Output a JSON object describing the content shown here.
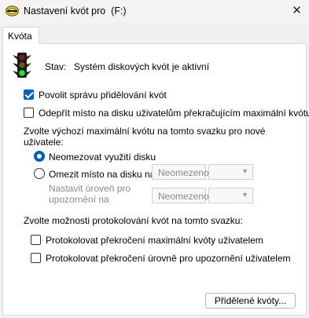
{
  "window": {
    "title": "Nastavení kvót pro  (F:)",
    "close_glyph": "✕"
  },
  "tabs": [
    {
      "label": "Kvóta"
    }
  ],
  "status": {
    "label": "Stav:",
    "value": "Systém diskových kvót je aktivní"
  },
  "options": {
    "enable_management": {
      "label": "Povolit správu přidělování kvót",
      "checked": true
    },
    "deny_space": {
      "label": "Odepřít místo na disku uživatelům překračujícím maximální kvótu",
      "checked": false
    }
  },
  "default_quota": {
    "heading_line1": "Zvolte výchozí maximální kvótu na tomto svazku pro nové",
    "heading_line2": "uživatele:",
    "no_limit": {
      "label": "Neomezovat využití disku",
      "selected": true
    },
    "limit": {
      "label": "Omezit místo na disku na",
      "selected": false,
      "value": "Neomezeno"
    },
    "warning": {
      "label_line1": "Nastavit úroveň pro",
      "label_line2": "upozornění na",
      "value": "Neomezeno"
    }
  },
  "logging": {
    "heading": "Zvolte možnosti protokolování kvót na tomto svazku:",
    "log_limit": {
      "label": "Protokolovat překročení maximální kvóty uživatelem",
      "checked": false
    },
    "log_warning": {
      "label": "Protokolovat překročení úrovně pro upozornění uživatelem",
      "checked": false
    }
  },
  "buttons": {
    "quota_entries": "Přidělené kvóty..."
  }
}
